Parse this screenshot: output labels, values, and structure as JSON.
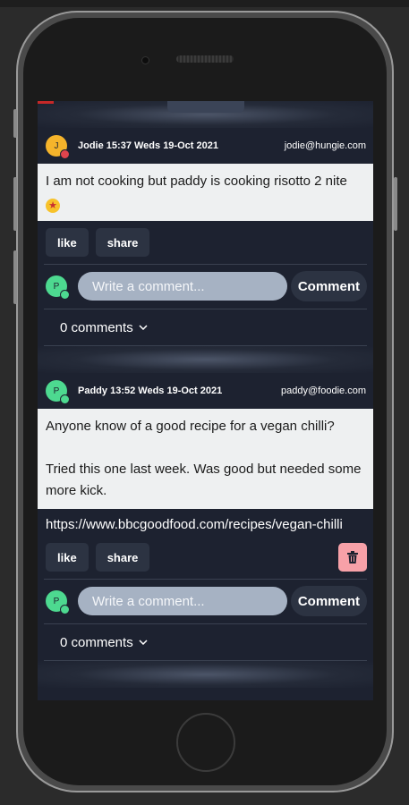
{
  "posts": [
    {
      "avatar_initial": "J",
      "avatar_color": "#f5b42b",
      "status_color": "#e0444d",
      "author": "Jodie",
      "time": "15:37",
      "date": "Weds 19-Oct 2021",
      "email": "jodie@hungie.com",
      "body": [
        "I am not cooking but paddy is cooking risotto 2 nite"
      ],
      "emoji": "star-struck-emoji",
      "like_label": "like",
      "share_label": "share",
      "comment_avatar_initial": "P",
      "comment_placeholder": "Write a comment...",
      "comment_button": "Comment",
      "comments_count_label": "0 comments"
    },
    {
      "avatar_initial": "P",
      "avatar_color": "#4dd990",
      "status_color": "#4dd990",
      "author": "Paddy",
      "time": "13:52",
      "date": "Weds 19-Oct 2021",
      "email": "paddy@foodie.com",
      "body": [
        "Anyone know of a good recipe for a vegan chilli?",
        "Tried this one last week. Was good but needed some more kick."
      ],
      "link": "https://www.bbcgoodfood.com/recipes/vegan-chilli",
      "like_label": "like",
      "share_label": "share",
      "delete_icon": "trash-icon",
      "comment_avatar_initial": "P",
      "comment_placeholder": "Write a comment...",
      "comment_button": "Comment",
      "comments_count_label": "0 comments"
    }
  ]
}
